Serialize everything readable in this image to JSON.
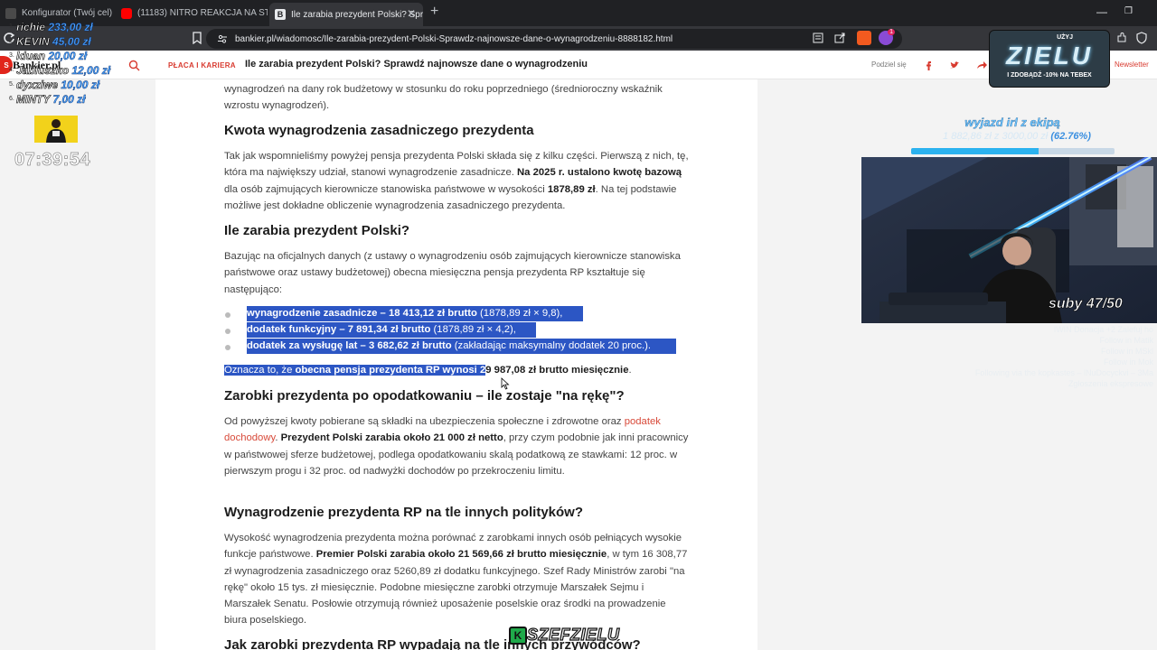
{
  "browser": {
    "tabs": [
      {
        "title": "Konfigurator (Twój cel)",
        "favicon_color": "#4a4a4a"
      },
      {
        "title": "(11183) NITRO REAKCJA NA STANDU",
        "favicon_color": "#ff0000"
      },
      {
        "title": "Ile zarabia prezydent Polski? Spr",
        "favicon_color": "#e8eaed"
      }
    ],
    "new_tab_symbol": "+",
    "url": "bankier.pl/wiadomosc/Ile-zarabia-prezydent-Polski-Sprawdz-najnowsze-dane-o-wynagrodzeniu-8888182.html",
    "window_controls": {
      "minimize": "—",
      "maximize": "❐",
      "close": "✕"
    },
    "extension_badge": "1"
  },
  "site": {
    "logo": "Bankier.pl",
    "category": "PŁACA I KARIERA",
    "header_title": "Ile zarabia prezydent Polski? Sprawdź najnowsze dane o wynagrodzeniu",
    "share_label": "Podziel się",
    "newsletter_label": "Newsletter"
  },
  "article": {
    "intro_lines": [
      "wynagrodzeń na dany rok budżetowy w stosunku do roku poprzedniego (średnioroczny wskaźnik",
      "wzrostu wynagrodzeń)."
    ],
    "h_kwota": "Kwota wynagrodzenia zasadniczego prezydenta",
    "p1": {
      "a": "Tak jak wspomnieliśmy powyżej pensja prezydenta Polski składa się z kilku części. Pierwszą z nich, tę, która ma największy udział, stanowi wynagrodzenie zasadnicze. ",
      "b": "Na 2025 r. ustalono kwotę bazową",
      "c": " dla osób zajmujących kierownicze stanowiska państwowe w wysokości ",
      "d": "1878,89 zł",
      "e": ". Na tej podstawie możliwe jest dokładne obliczenie wynagrodzenia zasadniczego prezydenta."
    },
    "h_ile": "Ile zarabia prezydent Polski?",
    "p2": "Bazując na oficjalnych danych (z ustawy o wynagrodzeniu osób zajmujących kierownicze stanowiska państwowe oraz ustawy budżetowej) obecna miesięczna pensja prezydenta RP kształtuje się następująco:",
    "bullets": [
      {
        "bold": "wynagrodzenie zasadnicze – 18 413,12 zł brutto",
        "rest": " (1878,89 zł × 9,8),"
      },
      {
        "bold": "dodatek funkcyjny – 7 891,34 zł brutto",
        "rest": " (1878,89 zł × 4,2),"
      },
      {
        "bold": "dodatek za wysługę lat – 3 682,62 zł brutto",
        "rest": " (zakładając maksymalny dodatek 20 proc.)."
      }
    ],
    "summary": {
      "sel_plain": "Oznacza to, że ",
      "sel_bold": "obecna pensja prezydenta RP wynosi 2",
      "rest_bold": "9 987,08 zł brutto miesięcznie",
      "end": "."
    },
    "h_netto": "Zarobki prezydenta po opodatkowaniu – ile zostaje \"na rękę\"?",
    "p3": {
      "a": "Od powyższej kwoty pobierane są składki na ubezpieczenia społeczne i zdrowotne oraz ",
      "link": "podatek dochodowy",
      "b": ". ",
      "c": "Prezydent Polski zarabia około 21 000 zł netto",
      "d": ", przy czym podobnie jak inni pracownicy w państwowej sferze budżetowej, podlega opodatkowaniu skalą podatkową ze stawkami: 12 proc. w pierwszym progu i 32 proc. od nadwyżki dochodów po przekroczeniu limitu."
    },
    "h_tle": "Wynagrodzenie prezydenta RP na tle innych polityków?",
    "p4": {
      "a": "Wysokość wynagrodzenia prezydenta można porównać z zarobkami innych osób pełniących wysokie funkcje państwowe. ",
      "b": "Premier Polski zarabia około 21 569,66 zł brutto miesięcznie",
      "c": ", w tym 16 308,77 zł wynagrodzenia zasadniczego oraz 5260,89 zł dodatku funkcyjnego. Szef Rady Ministrów zarobi \"na rękę\" około 15 tys. zł miesięcznie. Podobne miesięczne zarobki otrzymuje Marszałek Sejmu i Marszałek Senatu.  Posłowie otrzymują również uposażenie poselskie oraz środki na prowadzenie biura poselskiego."
    },
    "h_last": "Jak zarobki prezydenta RP wypadają na tle innych przywódców?"
  },
  "overlay": {
    "donations": [
      {
        "rank": "1.",
        "name": "richie",
        "amount": "233,00 zł"
      },
      {
        "rank": "2.",
        "name": "KEVIN",
        "amount": "45,00 zł"
      },
      {
        "rank": "3.",
        "name": "lduan",
        "amount": "20,00 zł"
      },
      {
        "rank": "4.",
        "name": "Jabluszko",
        "amount": "12,00 zł"
      },
      {
        "rank": "5.",
        "name": "dyxziwe",
        "amount": "10,00 zł"
      },
      {
        "rank": "6.",
        "name": "MINTY",
        "amount": "7,00 zł"
      }
    ],
    "clock": "07:39:54",
    "promo": {
      "top": "UŻYJ",
      "code": "ZIELU",
      "bottom": "I ZDOBĄDŹ -10% NA TEBEX"
    },
    "goal": {
      "title": "wyjazd irl z ekipą",
      "value": "1 882,86 zł z 3000,00 zł",
      "percent_label": "(62.76%)",
      "progress": 0.6276
    },
    "subs": "suby 47/50",
    "events": [
      "IWIN Donacja +2 Zalefuj ho",
      "Follow in Matik",
      "Follow in MSkl",
      "Follow in Mok",
      "Following via the kopkastes – lNuDocyckvi – 3Ma",
      "Zgłoszenia ekspresowe"
    ],
    "watermark": "SZEFZIELU",
    "watermark_badge": "K"
  },
  "colors": {
    "accent": "#d83a2f",
    "selection": "#2c56c4",
    "donation_value": "#4aa3ff"
  }
}
